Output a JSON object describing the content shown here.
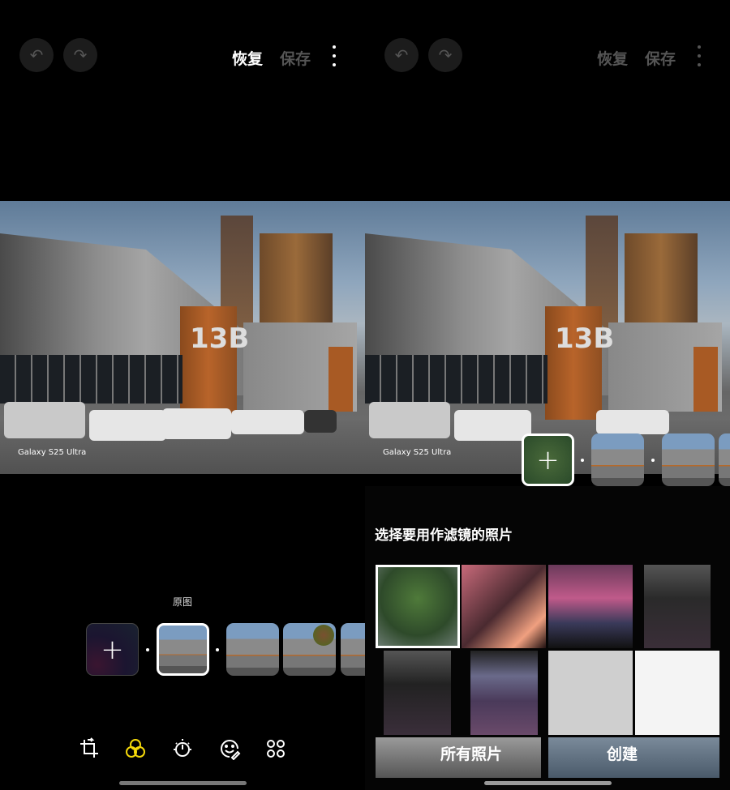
{
  "left": {
    "toolbar": {
      "undo": "undo-icon",
      "redo": "redo-icon",
      "revert_label": "恢复",
      "save_label": "保存"
    },
    "photo": {
      "watermark": "Galaxy S25 Ultra",
      "sign": "13B"
    },
    "filters": {
      "original_label": "原图"
    },
    "tools": [
      "crop-rotate-icon",
      "filters-icon",
      "adjust-brightness-icon",
      "decorations-icon",
      "more-tools-icon"
    ],
    "accent": "#f5d90a"
  },
  "right": {
    "toolbar": {
      "revert_label": "恢复",
      "save_label": "保存"
    },
    "photo": {
      "watermark": "Galaxy S25 Ultra",
      "sign": "13B"
    },
    "picker": {
      "title": "选择要用作滤镜的照片",
      "all_photos_tab": "所有照片",
      "create_tab": "创建"
    }
  }
}
